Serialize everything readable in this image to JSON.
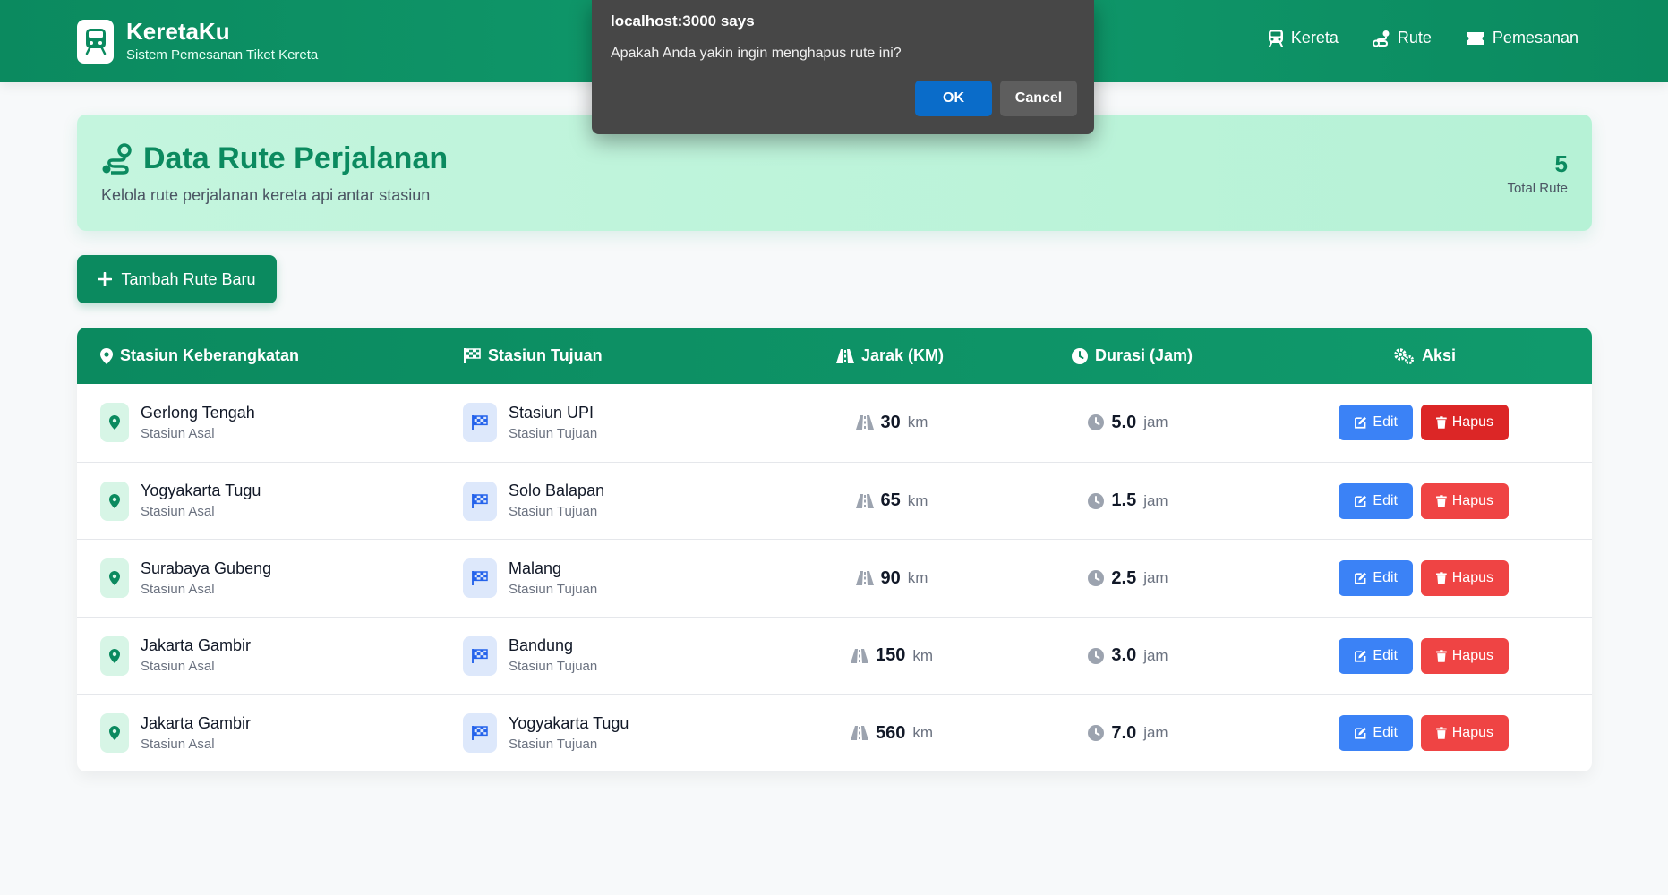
{
  "navbar": {
    "brand_title": "KeretaKu",
    "brand_subtitle": "Sistem Pemesanan Tiket Kereta",
    "links": [
      {
        "label": "Kereta",
        "icon": "train-icon"
      },
      {
        "label": "Rute",
        "icon": "route-icon"
      },
      {
        "label": "Pemesanan",
        "icon": "ticket-icon"
      }
    ]
  },
  "header": {
    "title": "Data Rute Perjalanan",
    "subtitle": "Kelola rute perjalanan kereta api antar stasiun",
    "total_value": "5",
    "total_label": "Total Rute"
  },
  "add_button_label": "Tambah Rute Baru",
  "table": {
    "headers": {
      "departure": "Stasiun Keberangkatan",
      "destination": "Stasiun Tujuan",
      "distance": "Jarak (KM)",
      "duration": "Durasi (Jam)",
      "actions": "Aksi"
    },
    "origin_role": "Stasiun Asal",
    "dest_role": "Stasiun Tujuan",
    "distance_unit": "km",
    "duration_unit": "jam",
    "edit_label": "Edit",
    "delete_label": "Hapus",
    "rows": [
      {
        "origin": "Gerlong Tengah",
        "destination": "Stasiun UPI",
        "distance": "30",
        "duration": "5.0"
      },
      {
        "origin": "Yogyakarta Tugu",
        "destination": "Solo Balapan",
        "distance": "65",
        "duration": "1.5"
      },
      {
        "origin": "Surabaya Gubeng",
        "destination": "Malang",
        "distance": "90",
        "duration": "2.5"
      },
      {
        "origin": "Jakarta Gambir",
        "destination": "Bandung",
        "distance": "150",
        "duration": "3.0"
      },
      {
        "origin": "Jakarta Gambir",
        "destination": "Yogyakarta Tugu",
        "distance": "560",
        "duration": "7.0"
      }
    ]
  },
  "dialog": {
    "title": "localhost:3000 says",
    "message": "Apakah Anda yakin ingin menghapus rute ini?",
    "ok_label": "OK",
    "cancel_label": "Cancel"
  },
  "colors": {
    "primary": "#0b8a5f",
    "edit": "#3b82f6",
    "delete": "#ef4444",
    "dialog_ok": "#0a6cc9"
  }
}
